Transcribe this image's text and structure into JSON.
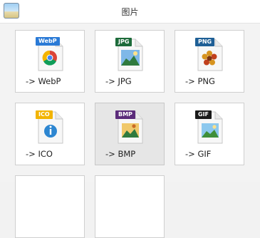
{
  "window": {
    "title": "图片"
  },
  "formats": [
    {
      "label": "-> WebP",
      "badge": "WebP",
      "badge_color": "#2a7ad6",
      "icon": "webp-chrome-icon"
    },
    {
      "label": "-> JPG",
      "badge": "JPG",
      "badge_color": "#1d6b3a",
      "icon": "jpg-landscape-icon"
    },
    {
      "label": "-> PNG",
      "badge": "PNG",
      "badge_color": "#1e5f96",
      "icon": "png-flower-icon"
    },
    {
      "label": "-> ICO",
      "badge": "ICO",
      "badge_color": "#f2b400",
      "icon": "ico-info-icon"
    },
    {
      "label": "-> BMP",
      "badge": "BMP",
      "badge_color": "#5b2b7a",
      "icon": "bmp-image-icon"
    },
    {
      "label": "-> GIF",
      "badge": "GIF",
      "badge_color": "#1a1a1a",
      "icon": "gif-image-icon"
    }
  ]
}
